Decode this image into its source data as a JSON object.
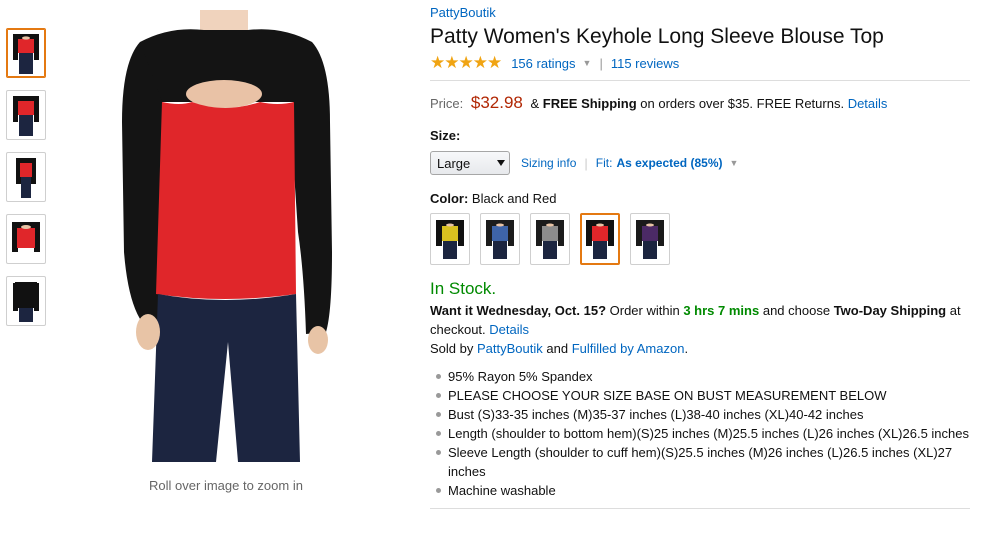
{
  "thumbnails": [
    {
      "label": "front view",
      "selected": true
    },
    {
      "label": "front view 2",
      "selected": false
    },
    {
      "label": "side view",
      "selected": false
    },
    {
      "label": "detail view",
      "selected": false
    },
    {
      "label": "back view",
      "selected": false
    }
  ],
  "image": {
    "zoom_note": "Roll over image to zoom in"
  },
  "product": {
    "brand": "PattyBoutik",
    "title": "Patty Women's Keyhole Long Sleeve Blouse Top",
    "stars": "★★★★★",
    "ratings": "156 ratings",
    "reviews": "115 reviews"
  },
  "price": {
    "label": "Price:",
    "amount": "$32.98",
    "amp": "&",
    "free_shipping": "FREE Shipping",
    "shipping_text": "on orders over $35. FREE Returns.",
    "details_link": "Details"
  },
  "size": {
    "label": "Size:",
    "selected": "Large",
    "sizing_info": "Sizing info",
    "fit_label": "Fit:",
    "fit_value": "As expected (85%)"
  },
  "color": {
    "label": "Color:",
    "selected": "Black and Red",
    "swatches": [
      {
        "name": "black-yellow",
        "body": "#111111",
        "panel": "#d8c020"
      },
      {
        "name": "black-blue",
        "body": "#1b1b1b",
        "panel": "#3e64a8"
      },
      {
        "name": "black-grey",
        "body": "#1b1b1b",
        "panel": "#8c8c8c"
      },
      {
        "name": "black-red",
        "body": "#111111",
        "panel": "#e0262a"
      },
      {
        "name": "black-purple",
        "body": "#1a1a1a",
        "panel": "#4b2a66"
      }
    ],
    "selected_index": 3
  },
  "availability": {
    "stock": "In Stock.",
    "want_it": "Want it Wednesday, Oct. 15?",
    "order_within": "Order within",
    "time_left": "3 hrs 7 mins",
    "choose": "and choose",
    "two_day": "Two-Day Shipping",
    "at_checkout": "at checkout.",
    "details_link": "Details",
    "sold_by": "Sold by",
    "seller": "PattyBoutik",
    "and": "and",
    "fulfilled": "Fulfilled by Amazon",
    "period": "."
  },
  "bullets": [
    "95% Rayon 5% Spandex",
    "PLEASE CHOOSE YOUR SIZE BASE ON BUST MEASUREMENT BELOW",
    "Bust (S)33-35 inches (M)35-37 inches (L)38-40 inches (XL)40-42 inches",
    "Length (shoulder to bottom hem)(S)25 inches (M)25.5 inches (L)26 inches (XL)26.5 inches",
    "Sleeve Length (shoulder to cuff hem)(S)25.5 inches (M)26 inches (L)26.5 inches (XL)27 inches",
    "Machine washable"
  ],
  "colors": {
    "link": "#0066c0",
    "price": "#b12704",
    "in_stock": "#008a00",
    "star": "#f0a413",
    "selected_border": "#e47911"
  }
}
